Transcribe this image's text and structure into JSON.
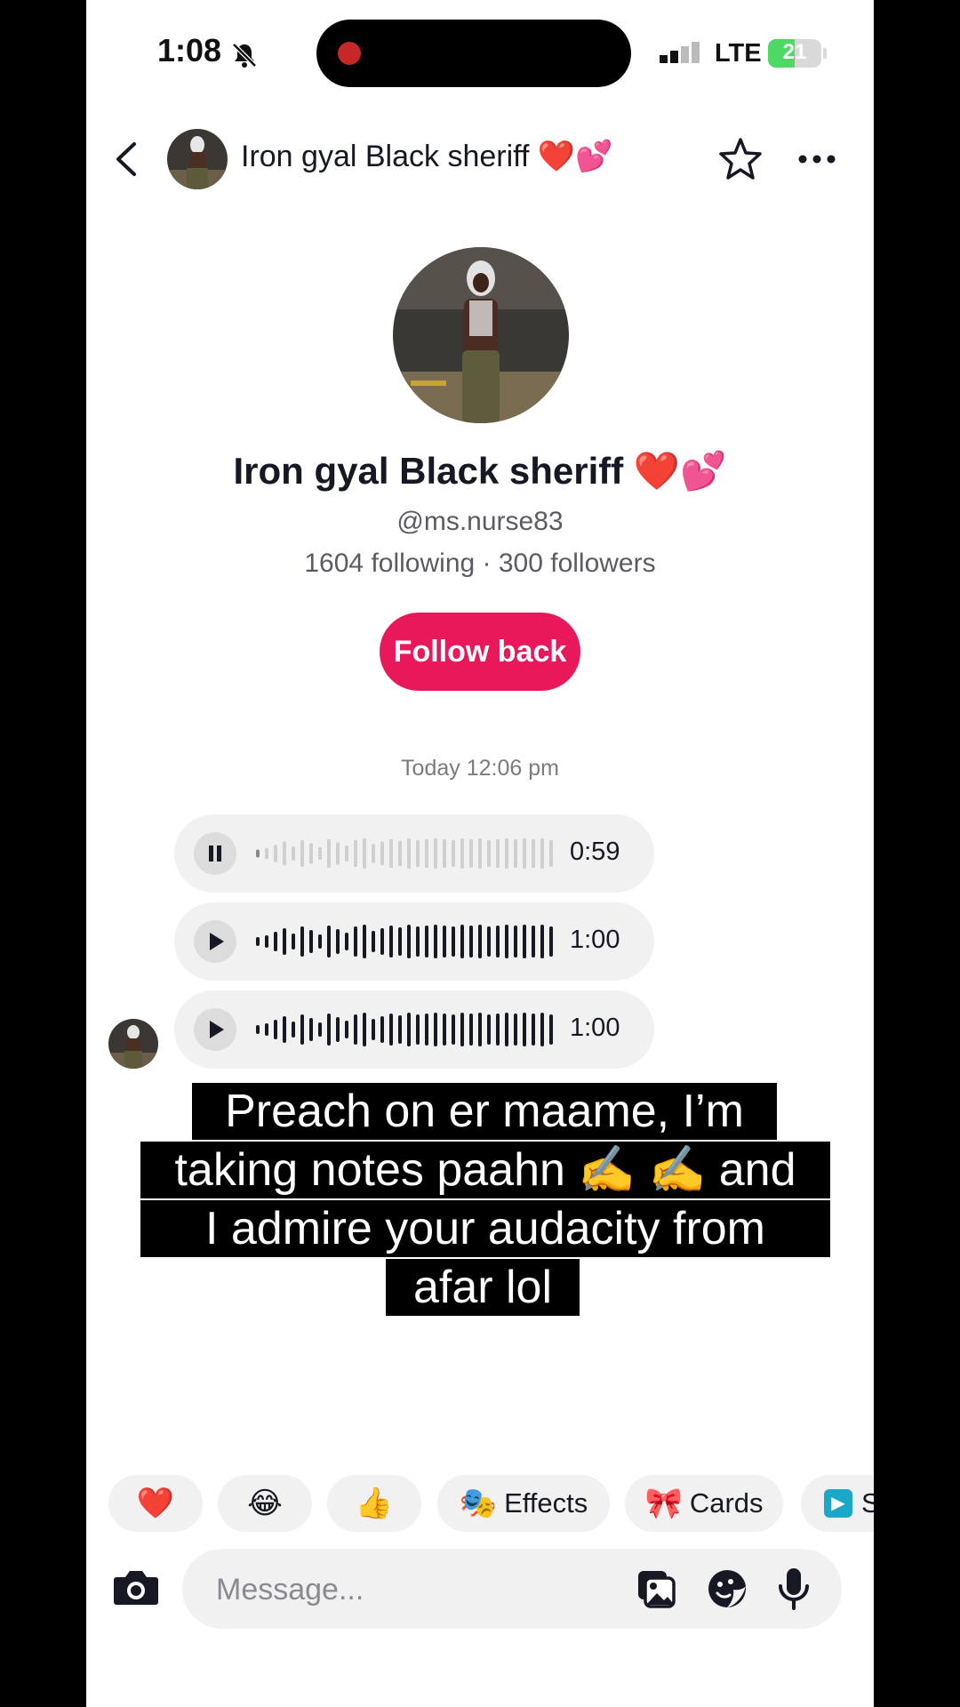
{
  "status": {
    "time": "1:08",
    "network": "LTE",
    "battery": "21"
  },
  "header": {
    "name": "Iron gyal Black sheriff ❤️💕"
  },
  "profile": {
    "name": "Iron gyal Black sheriff ❤️💕",
    "handle": "@ms.nurse83",
    "stats": "1604 following · 300 followers",
    "follow_label": "Follow back"
  },
  "chat": {
    "timestamp": "Today 12:06 pm",
    "voice_messages": [
      {
        "duration": "0:59",
        "state": "playing"
      },
      {
        "duration": "1:00",
        "state": "paused"
      },
      {
        "duration": "1:00",
        "state": "paused"
      }
    ]
  },
  "caption": {
    "lines": [
      "Preach on er maame, I’m",
      "taking notes paahn ✍️ ✍️  and",
      "I admire your audacity from",
      "afar lol"
    ]
  },
  "quick_replies": [
    {
      "icon": "❤️",
      "label": ""
    },
    {
      "icon": "😂",
      "label": ""
    },
    {
      "icon": "👍",
      "label": ""
    },
    {
      "icon": "🎭",
      "label": "Effects"
    },
    {
      "icon": "🎀",
      "label": "Cards"
    },
    {
      "icon": "▶",
      "label": "S"
    }
  ],
  "composer": {
    "placeholder": "Message..."
  },
  "colors": {
    "accent": "#e8185a",
    "bubble": "#f1f1f2",
    "battery": "#4cd964"
  }
}
